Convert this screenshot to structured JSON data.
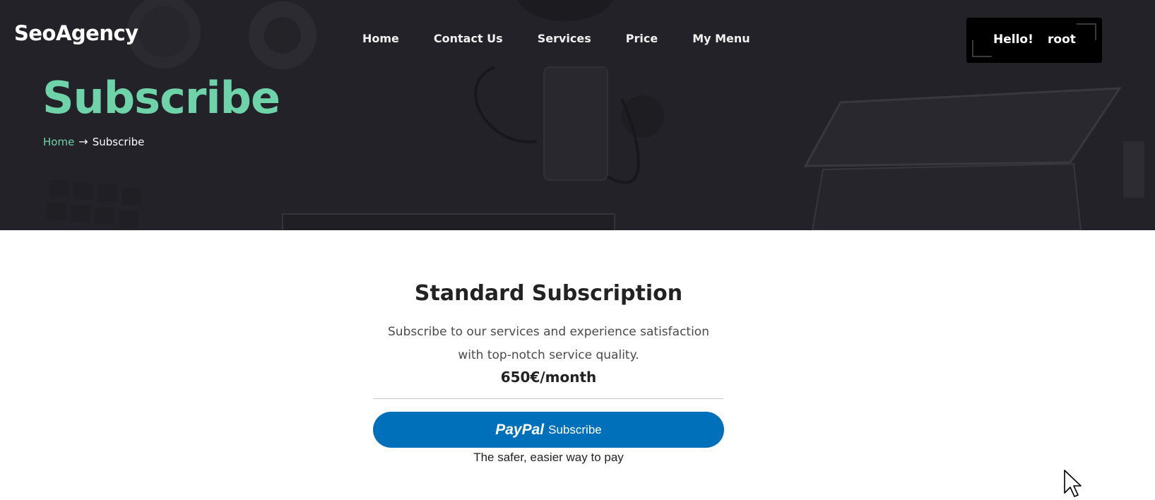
{
  "header": {
    "logo": "SeoAgency",
    "nav": [
      {
        "label": "Home"
      },
      {
        "label": "Contact Us"
      },
      {
        "label": "Services"
      },
      {
        "label": "Price"
      },
      {
        "label": "My Menu"
      }
    ],
    "user": {
      "greeting": "Hello!",
      "name": "root"
    }
  },
  "hero": {
    "title": "Subscribe",
    "breadcrumb": {
      "home": "Home",
      "separator": "→",
      "current": "Subscribe"
    }
  },
  "subscription": {
    "title": "Standard Subscription",
    "description": "Subscribe to our services and experience satisfaction with top-notch service quality.",
    "price": "650€/month",
    "paypal": {
      "logo": "PayPal",
      "label": "Subscribe",
      "tagline": "The safer, easier way to pay"
    }
  },
  "colors": {
    "accent": "#6fd3a9",
    "hero_bg": "#232228",
    "paypal_blue": "#0070ba"
  }
}
